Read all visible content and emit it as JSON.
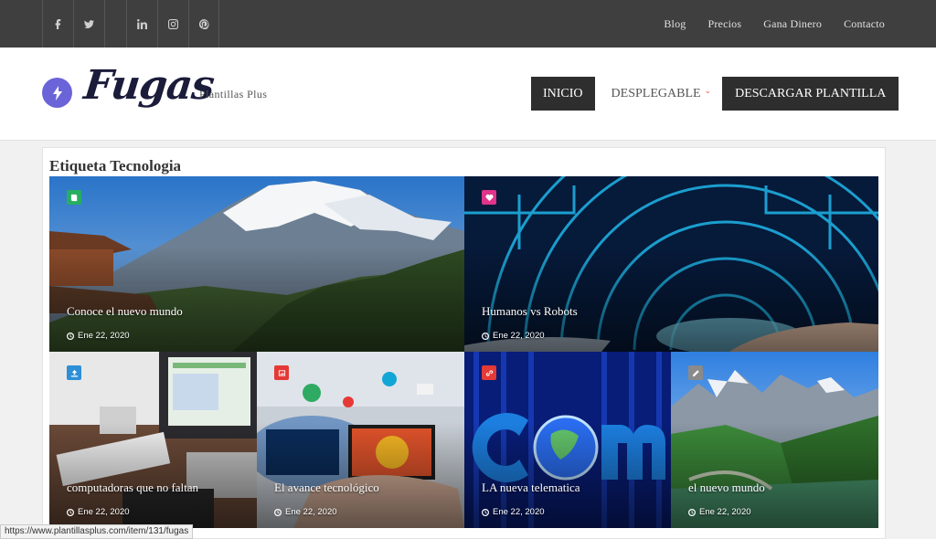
{
  "social": [
    "facebook-icon",
    "twitter-icon",
    "linkedin-icon",
    "instagram-icon",
    "pinterest-icon"
  ],
  "topmenu": [
    "Blog",
    "Precios",
    "Gana Dinero",
    "Contacto"
  ],
  "header": {
    "logo": "Fugas",
    "tagline": "Plantillas Plus",
    "nav": {
      "inicio": "INICIO",
      "desplegable": "DESPLEGABLE",
      "descargar": "DESCARGAR PLANTILLA"
    }
  },
  "colors": {
    "topbar": "#3f3f3f",
    "logo_circle": "#6b63d8",
    "nav_dark": "#2e2e2e",
    "caret": "#ee5555"
  },
  "section_title": "Etiqueta Tecnologia",
  "posts": [
    {
      "title": "Conoce el nuevo mundo",
      "date": "Ene 22, 2020",
      "badge_icon": "book-icon",
      "badge_color": "#27ae60"
    },
    {
      "title": "Humanos vs Robots",
      "date": "Ene 22, 2020",
      "badge_icon": "heart-icon",
      "badge_color": "#e0338a"
    },
    {
      "title": "computadoras que no faltan",
      "date": "Ene 22, 2020",
      "badge_icon": "upload-icon",
      "badge_color": "#2d8fd6"
    },
    {
      "title": "El avance tecnológico",
      "date": "Ene 22, 2020",
      "badge_icon": "image-icon",
      "badge_color": "#e53935"
    },
    {
      "title": "LA nueva telematica",
      "date": "Ene 22, 2020",
      "badge_icon": "link-icon",
      "badge_color": "#e53935"
    },
    {
      "title": "el nuevo mundo",
      "date": "Ene 22, 2020",
      "badge_icon": "pencil-icon",
      "badge_color": "#8a8a8a"
    }
  ],
  "status_url": "https://www.plantillasplus.com/item/131/fugas"
}
